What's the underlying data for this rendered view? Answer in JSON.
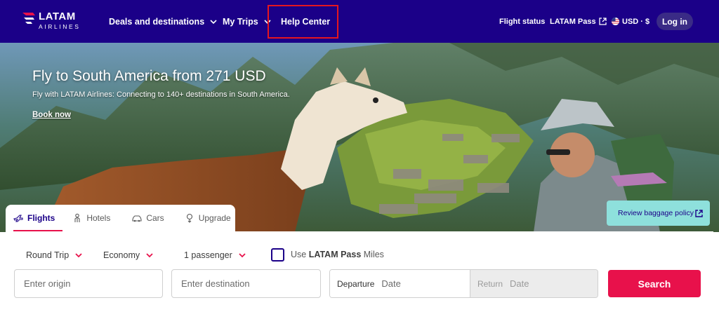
{
  "brand": {
    "name": "LATAM",
    "sub": "AIRLINES"
  },
  "nav": {
    "deals": "Deals and destinations",
    "trips": "My Trips",
    "help": "Help Center"
  },
  "header_right": {
    "flight_status": "Flight status",
    "latam_pass": "LATAM Pass",
    "currency": "USD · $",
    "login": "Log in"
  },
  "hero": {
    "title": "Fly to South America from 271 USD",
    "subtitle": "Fly with LATAM Airlines: Connecting to 140+ destinations in South America.",
    "cta": "Book now"
  },
  "baggage": "Review baggage policy",
  "tabs": [
    {
      "label": "Flights",
      "icon": "plane-icon"
    },
    {
      "label": "Hotels",
      "icon": "person-icon"
    },
    {
      "label": "Cars",
      "icon": "car-icon"
    },
    {
      "label": "Upgrade",
      "icon": "upgrade-icon"
    }
  ],
  "search": {
    "trip_type": "Round Trip",
    "cabin": "Economy",
    "passengers": "1 passenger",
    "miles_prefix": "Use",
    "miles_brand": "LATAM Pass",
    "miles_suffix": "Miles",
    "origin_placeholder": "Enter origin",
    "destination_placeholder": "Enter destination",
    "departure_label": "Departure",
    "departure_value": "Date",
    "return_label": "Return",
    "return_value": "Date",
    "submit": "Search"
  },
  "colors": {
    "header_bg": "#1b0088",
    "accent": "#e8114b",
    "highlight_box": "#e5161f",
    "baggage_bg": "#8ee0dc"
  }
}
